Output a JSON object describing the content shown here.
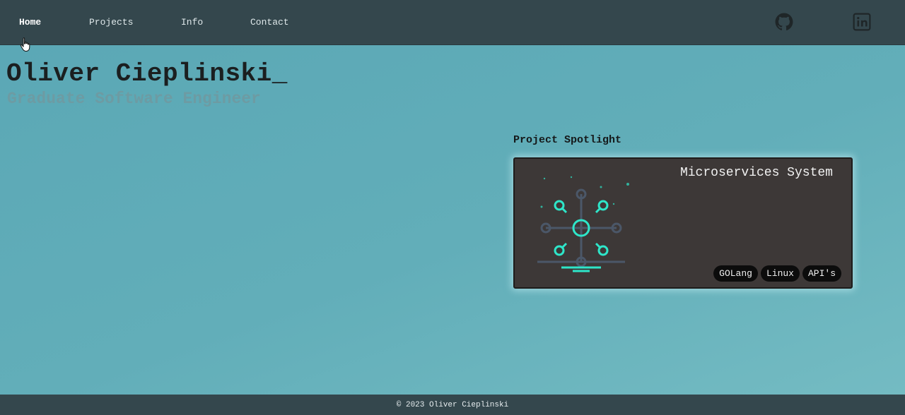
{
  "nav": {
    "items": [
      {
        "label": "Home",
        "active": true
      },
      {
        "label": "Projects",
        "active": false
      },
      {
        "label": "Info",
        "active": false
      },
      {
        "label": "Contact",
        "active": false
      }
    ],
    "social_icons": [
      "github-icon",
      "linkedin-icon"
    ]
  },
  "hero": {
    "name": "Oliver Cieplinski_",
    "subtitle": "Graduate Software Engineer"
  },
  "spotlight": {
    "heading": "Project Spotlight",
    "card": {
      "title": "Microservices System",
      "icon": "microservices-network-icon",
      "tags": [
        "GOLang",
        "Linux",
        "API's"
      ]
    }
  },
  "footer": {
    "text": "© 2023 Oliver Cieplinski"
  },
  "colors": {
    "nav_bg": "#34474d",
    "page_bg": "#62aeb9",
    "card_bg": "#3d3837",
    "accent": "#2ee6c9"
  }
}
